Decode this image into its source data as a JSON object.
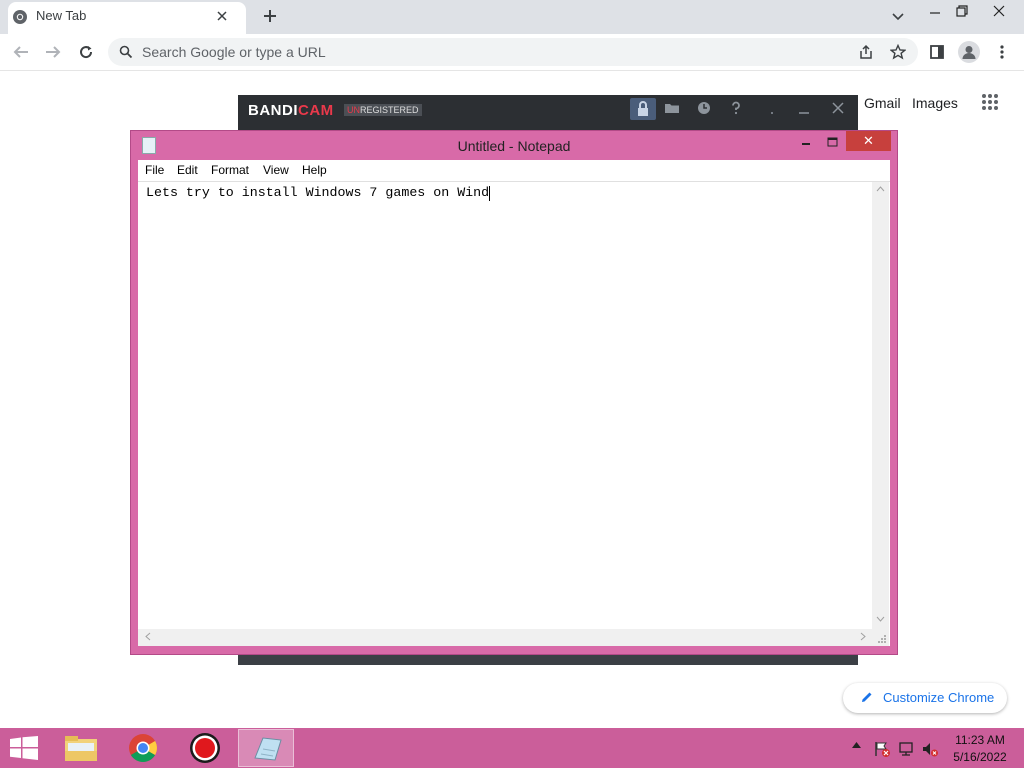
{
  "browser": {
    "tab": {
      "title": "New Tab",
      "favicon": "chrome-icon",
      "close": "close-icon"
    },
    "new_tab": "plus-icon",
    "omnibox": {
      "placeholder": "Search Google or type a URL"
    },
    "ntp": {
      "gmail": "Gmail",
      "images": "Images"
    },
    "customize": {
      "label": "Customize Chrome",
      "icon": "pencil-icon"
    }
  },
  "bandicam": {
    "logo_first": "BANDI",
    "logo_second": "CAM",
    "badge_first": "UN",
    "badge_second": "REGISTERED"
  },
  "notepad": {
    "title": "Untitled - Notepad",
    "menu": [
      "File",
      "Edit",
      "Format",
      "View",
      "Help"
    ],
    "content": "Lets try to install Windows 7 games on Wind",
    "close_symbol": "✕"
  },
  "taskbar": {
    "items": [
      "file-explorer-icon",
      "chrome-icon",
      "bandicam-record-icon",
      "notepad-icon"
    ],
    "clock": {
      "time": "11:23 AM",
      "date": "5/16/2022"
    }
  },
  "colors": {
    "accent": "#d86aa8",
    "taskbar": "#cb5e9a",
    "notepad_close": "#c7403d",
    "bandicam_red": "#e9394b",
    "link_blue": "#1a73e8"
  }
}
